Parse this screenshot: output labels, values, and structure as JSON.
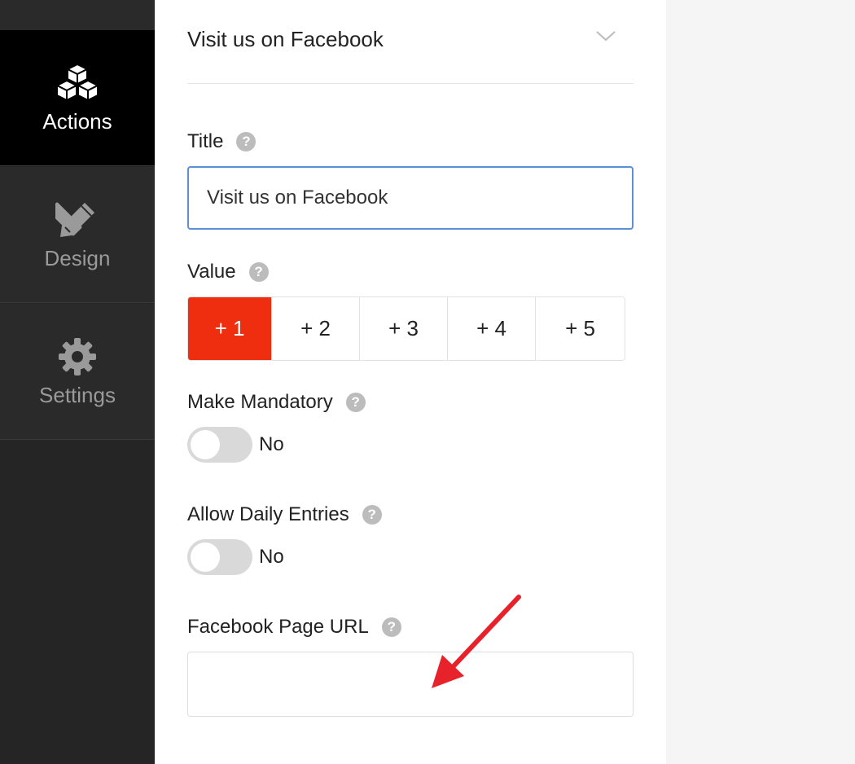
{
  "sidebar": {
    "items": [
      {
        "label": "Actions",
        "icon": "cubes-icon",
        "active": true
      },
      {
        "label": "Design",
        "icon": "pencil-ruler-icon",
        "active": false
      },
      {
        "label": "Settings",
        "icon": "gear-icon",
        "active": false
      }
    ]
  },
  "panel": {
    "header_title": "Visit us on Facebook",
    "title_label": "Title",
    "title_value": "Visit us on Facebook",
    "value_label": "Value",
    "value_options": [
      "+ 1",
      "+ 2",
      "+ 3",
      "+ 4",
      "+ 5"
    ],
    "value_selected": "+ 1",
    "mandatory_label": "Make Mandatory",
    "mandatory_state": "No",
    "daily_label": "Allow Daily Entries",
    "daily_state": "No",
    "url_label": "Facebook Page URL",
    "url_value": "",
    "help_glyph": "?"
  },
  "colors": {
    "selected": "#ee2e0e",
    "sidebar_bg": "#252525",
    "active_bg": "#000000",
    "focus_border": "#5b8fd6",
    "arrow": "#e8222a"
  }
}
